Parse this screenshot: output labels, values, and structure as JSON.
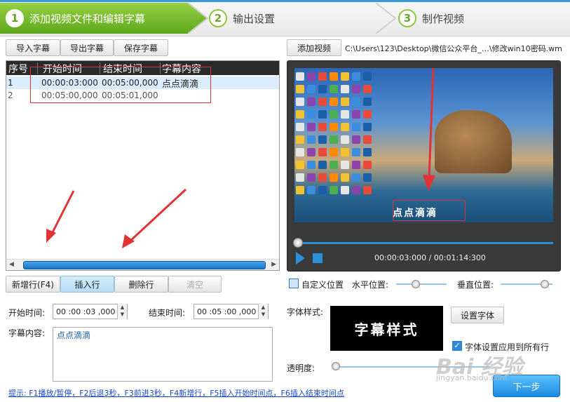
{
  "steps": [
    {
      "num": "1",
      "label": "添加视频文件和编辑字幕"
    },
    {
      "num": "2",
      "label": "输出设置"
    },
    {
      "num": "3",
      "label": "制作视频"
    }
  ],
  "toolbar": {
    "import": "导入字幕",
    "export": "导出字幕",
    "save": "保存字幕"
  },
  "add_video": "添加视频",
  "file_path": "C:\\Users\\123\\Desktop\\微信公众平台_…\\修改win10密码.wmv",
  "list": {
    "headers": [
      "序号",
      "开始时间",
      "结束时间",
      "字幕内容"
    ],
    "rows": [
      {
        "idx": "1",
        "start": "00:00:03:000",
        "end": "00:05:00,000",
        "text": "点点滴滴"
      },
      {
        "idx": "2",
        "start": "00:05:00,000",
        "end": "00:05:01,000",
        "text": ""
      }
    ]
  },
  "row_buttons": {
    "new": "新增行(F4)",
    "insert": "插入行",
    "delete": "删除行",
    "clear": "清空"
  },
  "player": {
    "timecode": "00:00:03:000 / 00:01:14:300",
    "overlay_text": "点点滴滴",
    "progress": 0.04
  },
  "position": {
    "custom": "自定义位置",
    "horizontal": "水平位置:",
    "vertical": "垂直位置:"
  },
  "editor": {
    "start_label": "开始时间:",
    "start_value": "00 :00 :03 ,000",
    "end_label": "结束时间:",
    "end_value": "00 :05 :00 ,000",
    "content_label": "字幕内容:",
    "content_value": "点点滴滴"
  },
  "font": {
    "label": "字体样式:",
    "preview": "字幕样式",
    "set_button": "设置字体",
    "apply_all": "字体设置应用到所有行"
  },
  "opacity_label": "透明度:",
  "hint": "提示: F1播放/暂停，F2后退3秒，F3前进3秒，F4新增行，F5插入开始时间点，F6插入结束时间点",
  "next": "下一步",
  "watermark": {
    "main": "Bai 经验",
    "sub": "jingyan.baidu.com"
  },
  "colors": {
    "step_active": "#5da81c",
    "accent": "#2a8fd8",
    "annotation": "#e23333"
  }
}
